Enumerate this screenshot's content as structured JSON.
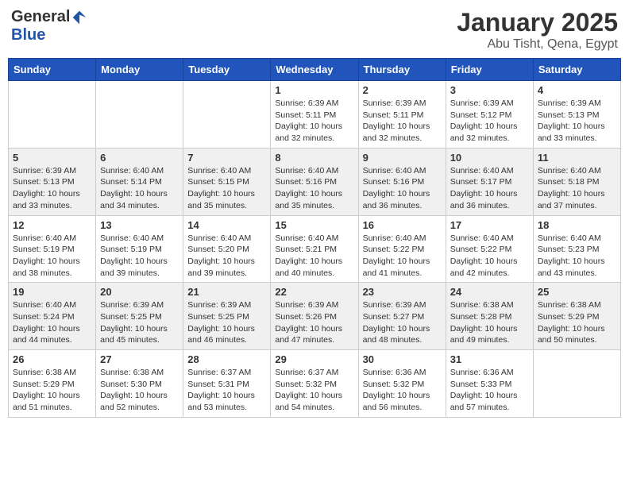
{
  "logo": {
    "general": "General",
    "blue": "Blue"
  },
  "header": {
    "title": "January 2025",
    "subtitle": "Abu Tisht, Qena, Egypt"
  },
  "weekdays": [
    "Sunday",
    "Monday",
    "Tuesday",
    "Wednesday",
    "Thursday",
    "Friday",
    "Saturday"
  ],
  "weeks": [
    [
      {
        "day": "",
        "sunrise": "",
        "sunset": "",
        "daylight": ""
      },
      {
        "day": "",
        "sunrise": "",
        "sunset": "",
        "daylight": ""
      },
      {
        "day": "",
        "sunrise": "",
        "sunset": "",
        "daylight": ""
      },
      {
        "day": "1",
        "sunrise": "Sunrise: 6:39 AM",
        "sunset": "Sunset: 5:11 PM",
        "daylight": "Daylight: 10 hours and 32 minutes."
      },
      {
        "day": "2",
        "sunrise": "Sunrise: 6:39 AM",
        "sunset": "Sunset: 5:11 PM",
        "daylight": "Daylight: 10 hours and 32 minutes."
      },
      {
        "day": "3",
        "sunrise": "Sunrise: 6:39 AM",
        "sunset": "Sunset: 5:12 PM",
        "daylight": "Daylight: 10 hours and 32 minutes."
      },
      {
        "day": "4",
        "sunrise": "Sunrise: 6:39 AM",
        "sunset": "Sunset: 5:13 PM",
        "daylight": "Daylight: 10 hours and 33 minutes."
      }
    ],
    [
      {
        "day": "5",
        "sunrise": "Sunrise: 6:39 AM",
        "sunset": "Sunset: 5:13 PM",
        "daylight": "Daylight: 10 hours and 33 minutes."
      },
      {
        "day": "6",
        "sunrise": "Sunrise: 6:40 AM",
        "sunset": "Sunset: 5:14 PM",
        "daylight": "Daylight: 10 hours and 34 minutes."
      },
      {
        "day": "7",
        "sunrise": "Sunrise: 6:40 AM",
        "sunset": "Sunset: 5:15 PM",
        "daylight": "Daylight: 10 hours and 35 minutes."
      },
      {
        "day": "8",
        "sunrise": "Sunrise: 6:40 AM",
        "sunset": "Sunset: 5:16 PM",
        "daylight": "Daylight: 10 hours and 35 minutes."
      },
      {
        "day": "9",
        "sunrise": "Sunrise: 6:40 AM",
        "sunset": "Sunset: 5:16 PM",
        "daylight": "Daylight: 10 hours and 36 minutes."
      },
      {
        "day": "10",
        "sunrise": "Sunrise: 6:40 AM",
        "sunset": "Sunset: 5:17 PM",
        "daylight": "Daylight: 10 hours and 36 minutes."
      },
      {
        "day": "11",
        "sunrise": "Sunrise: 6:40 AM",
        "sunset": "Sunset: 5:18 PM",
        "daylight": "Daylight: 10 hours and 37 minutes."
      }
    ],
    [
      {
        "day": "12",
        "sunrise": "Sunrise: 6:40 AM",
        "sunset": "Sunset: 5:19 PM",
        "daylight": "Daylight: 10 hours and 38 minutes."
      },
      {
        "day": "13",
        "sunrise": "Sunrise: 6:40 AM",
        "sunset": "Sunset: 5:19 PM",
        "daylight": "Daylight: 10 hours and 39 minutes."
      },
      {
        "day": "14",
        "sunrise": "Sunrise: 6:40 AM",
        "sunset": "Sunset: 5:20 PM",
        "daylight": "Daylight: 10 hours and 39 minutes."
      },
      {
        "day": "15",
        "sunrise": "Sunrise: 6:40 AM",
        "sunset": "Sunset: 5:21 PM",
        "daylight": "Daylight: 10 hours and 40 minutes."
      },
      {
        "day": "16",
        "sunrise": "Sunrise: 6:40 AM",
        "sunset": "Sunset: 5:22 PM",
        "daylight": "Daylight: 10 hours and 41 minutes."
      },
      {
        "day": "17",
        "sunrise": "Sunrise: 6:40 AM",
        "sunset": "Sunset: 5:22 PM",
        "daylight": "Daylight: 10 hours and 42 minutes."
      },
      {
        "day": "18",
        "sunrise": "Sunrise: 6:40 AM",
        "sunset": "Sunset: 5:23 PM",
        "daylight": "Daylight: 10 hours and 43 minutes."
      }
    ],
    [
      {
        "day": "19",
        "sunrise": "Sunrise: 6:40 AM",
        "sunset": "Sunset: 5:24 PM",
        "daylight": "Daylight: 10 hours and 44 minutes."
      },
      {
        "day": "20",
        "sunrise": "Sunrise: 6:39 AM",
        "sunset": "Sunset: 5:25 PM",
        "daylight": "Daylight: 10 hours and 45 minutes."
      },
      {
        "day": "21",
        "sunrise": "Sunrise: 6:39 AM",
        "sunset": "Sunset: 5:25 PM",
        "daylight": "Daylight: 10 hours and 46 minutes."
      },
      {
        "day": "22",
        "sunrise": "Sunrise: 6:39 AM",
        "sunset": "Sunset: 5:26 PM",
        "daylight": "Daylight: 10 hours and 47 minutes."
      },
      {
        "day": "23",
        "sunrise": "Sunrise: 6:39 AM",
        "sunset": "Sunset: 5:27 PM",
        "daylight": "Daylight: 10 hours and 48 minutes."
      },
      {
        "day": "24",
        "sunrise": "Sunrise: 6:38 AM",
        "sunset": "Sunset: 5:28 PM",
        "daylight": "Daylight: 10 hours and 49 minutes."
      },
      {
        "day": "25",
        "sunrise": "Sunrise: 6:38 AM",
        "sunset": "Sunset: 5:29 PM",
        "daylight": "Daylight: 10 hours and 50 minutes."
      }
    ],
    [
      {
        "day": "26",
        "sunrise": "Sunrise: 6:38 AM",
        "sunset": "Sunset: 5:29 PM",
        "daylight": "Daylight: 10 hours and 51 minutes."
      },
      {
        "day": "27",
        "sunrise": "Sunrise: 6:38 AM",
        "sunset": "Sunset: 5:30 PM",
        "daylight": "Daylight: 10 hours and 52 minutes."
      },
      {
        "day": "28",
        "sunrise": "Sunrise: 6:37 AM",
        "sunset": "Sunset: 5:31 PM",
        "daylight": "Daylight: 10 hours and 53 minutes."
      },
      {
        "day": "29",
        "sunrise": "Sunrise: 6:37 AM",
        "sunset": "Sunset: 5:32 PM",
        "daylight": "Daylight: 10 hours and 54 minutes."
      },
      {
        "day": "30",
        "sunrise": "Sunrise: 6:36 AM",
        "sunset": "Sunset: 5:32 PM",
        "daylight": "Daylight: 10 hours and 56 minutes."
      },
      {
        "day": "31",
        "sunrise": "Sunrise: 6:36 AM",
        "sunset": "Sunset: 5:33 PM",
        "daylight": "Daylight: 10 hours and 57 minutes."
      },
      {
        "day": "",
        "sunrise": "",
        "sunset": "",
        "daylight": ""
      }
    ]
  ]
}
